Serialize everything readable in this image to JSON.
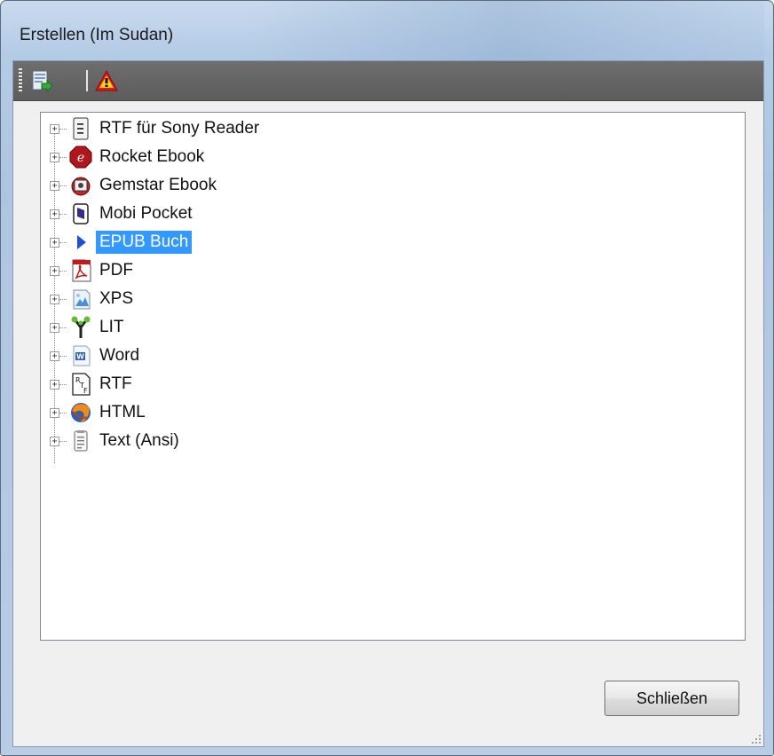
{
  "window": {
    "title": "Erstellen (Im Sudan)"
  },
  "toolbar": {
    "buttons": [
      {
        "icon": "export-icon"
      },
      {
        "icon": "warning-icon"
      }
    ]
  },
  "tree": {
    "selected_index": 4,
    "items": [
      {
        "label": "RTF für Sony Reader",
        "icon": "sony-reader-icon"
      },
      {
        "label": "Rocket Ebook",
        "icon": "rocket-ebook-icon"
      },
      {
        "label": "Gemstar Ebook",
        "icon": "gemstar-ebook-icon"
      },
      {
        "label": "Mobi Pocket",
        "icon": "mobipocket-icon"
      },
      {
        "label": "EPUB Buch",
        "icon": "epub-arrow-icon"
      },
      {
        "label": "PDF",
        "icon": "pdf-icon"
      },
      {
        "label": "XPS",
        "icon": "xps-icon"
      },
      {
        "label": "LIT",
        "icon": "lit-icon"
      },
      {
        "label": "Word",
        "icon": "word-icon"
      },
      {
        "label": "RTF",
        "icon": "rtf-icon"
      },
      {
        "label": "HTML",
        "icon": "firefox-html-icon"
      },
      {
        "label": "Text (Ansi)",
        "icon": "text-file-icon"
      }
    ]
  },
  "footer": {
    "close_label": "Schließen"
  },
  "colors": {
    "selection": "#3399ff",
    "toolbar": "#666666",
    "accent_warning": "#e8141c"
  }
}
